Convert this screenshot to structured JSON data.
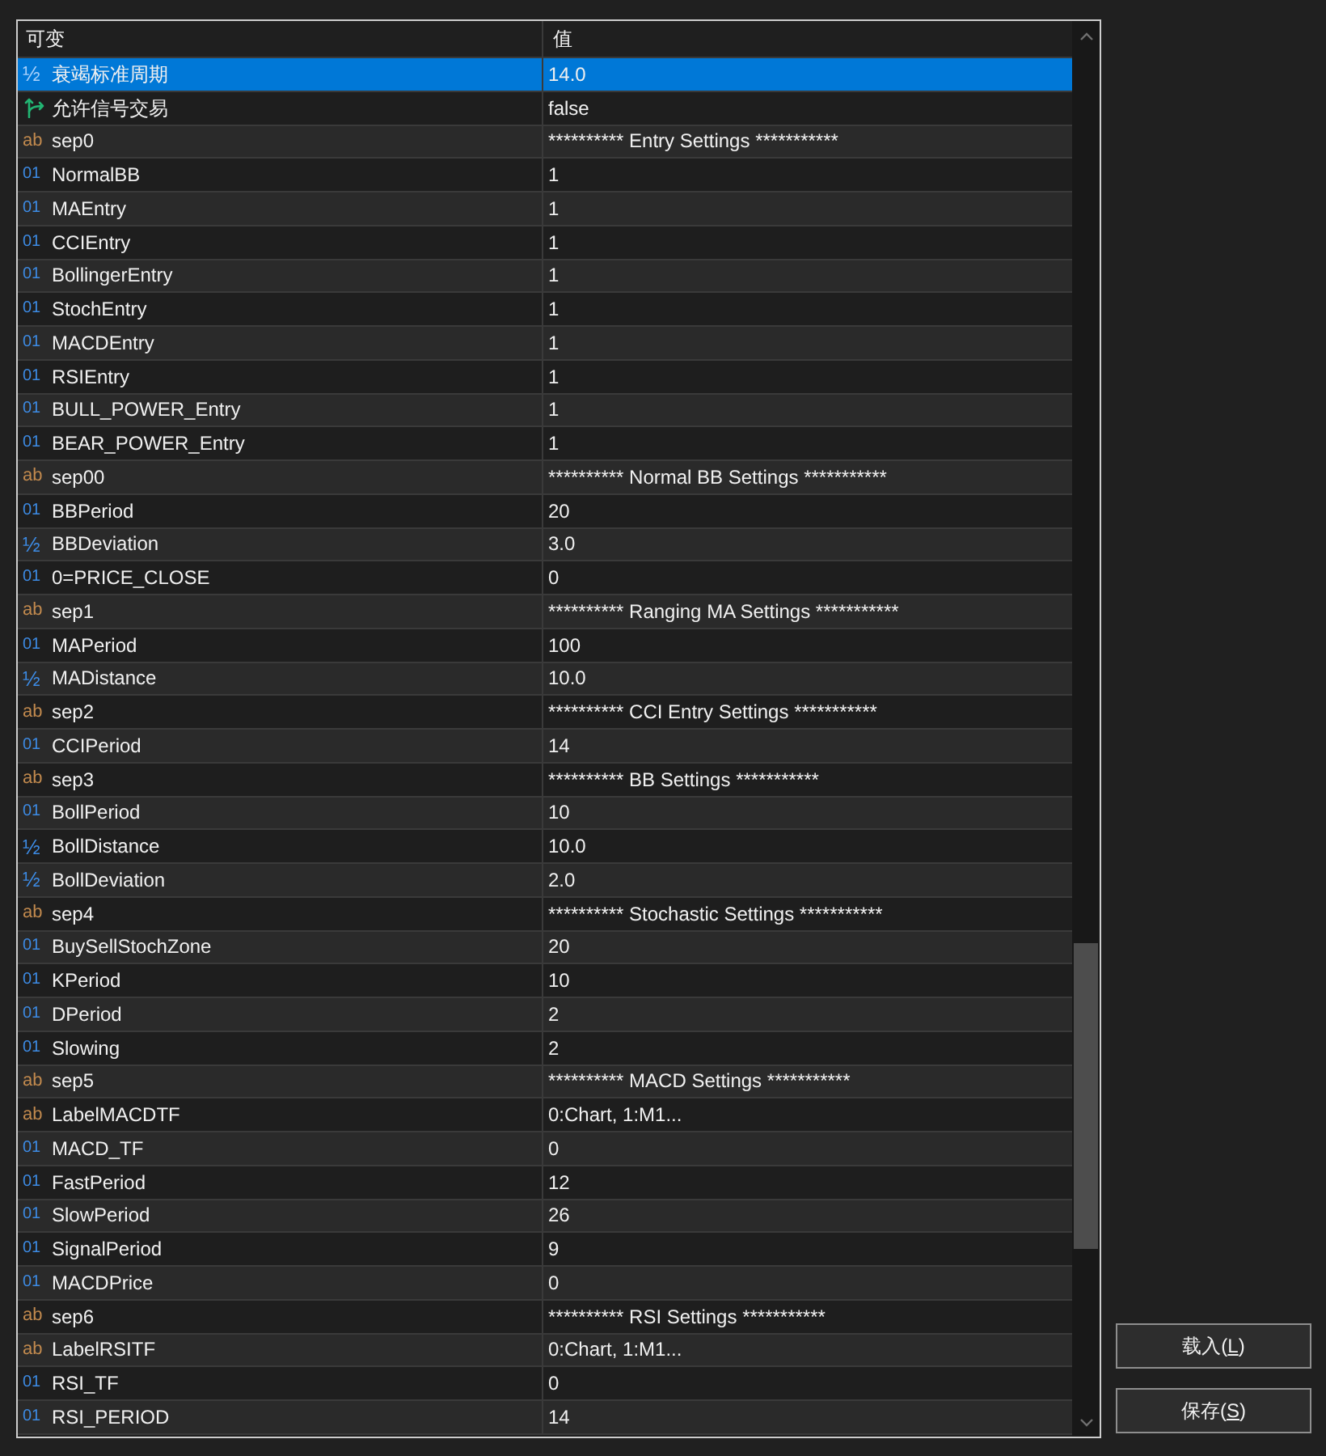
{
  "table": {
    "columns": [
      "可变",
      "值"
    ],
    "rows": [
      {
        "kind": "double",
        "icon": "½",
        "name": "衰竭标准周期",
        "value": "14.0",
        "selected": true
      },
      {
        "kind": "bool",
        "name": "允许信号交易",
        "value": "false",
        "selected": false
      },
      {
        "kind": "string",
        "icon": "ab",
        "name": "sep0",
        "value": "********** Entry Settings ***********",
        "selected": false
      },
      {
        "kind": "int",
        "icon": "01",
        "name": "NormalBB",
        "value": "1",
        "selected": false
      },
      {
        "kind": "int",
        "icon": "01",
        "name": "MAEntry",
        "value": "1",
        "selected": false
      },
      {
        "kind": "int",
        "icon": "01",
        "name": "CCIEntry",
        "value": "1",
        "selected": false
      },
      {
        "kind": "int",
        "icon": "01",
        "name": "BollingerEntry",
        "value": "1",
        "selected": false
      },
      {
        "kind": "int",
        "icon": "01",
        "name": "StochEntry",
        "value": "1",
        "selected": false
      },
      {
        "kind": "int",
        "icon": "01",
        "name": "MACDEntry",
        "value": "1",
        "selected": false
      },
      {
        "kind": "int",
        "icon": "01",
        "name": "RSIEntry",
        "value": "1",
        "selected": false
      },
      {
        "kind": "int",
        "icon": "01",
        "name": "BULL_POWER_Entry",
        "value": "1",
        "selected": false
      },
      {
        "kind": "int",
        "icon": "01",
        "name": "BEAR_POWER_Entry",
        "value": "1",
        "selected": false
      },
      {
        "kind": "string",
        "icon": "ab",
        "name": "sep00",
        "value": "********** Normal BB Settings ***********",
        "selected": false
      },
      {
        "kind": "int",
        "icon": "01",
        "name": "BBPeriod",
        "value": "20",
        "selected": false
      },
      {
        "kind": "double",
        "icon": "½",
        "name": "BBDeviation",
        "value": "3.0",
        "selected": false
      },
      {
        "kind": "int",
        "icon": "01",
        "name": "0=PRICE_CLOSE",
        "value": "0",
        "selected": false
      },
      {
        "kind": "string",
        "icon": "ab",
        "name": "sep1",
        "value": "********** Ranging MA Settings ***********",
        "selected": false
      },
      {
        "kind": "int",
        "icon": "01",
        "name": "MAPeriod",
        "value": "100",
        "selected": false
      },
      {
        "kind": "double",
        "icon": "½",
        "name": "MADistance",
        "value": "10.0",
        "selected": false
      },
      {
        "kind": "string",
        "icon": "ab",
        "name": "sep2",
        "value": "********** CCI Entry Settings ***********",
        "selected": false
      },
      {
        "kind": "int",
        "icon": "01",
        "name": "CCIPeriod",
        "value": "14",
        "selected": false
      },
      {
        "kind": "string",
        "icon": "ab",
        "name": "sep3",
        "value": "********** BB Settings ***********",
        "selected": false
      },
      {
        "kind": "int",
        "icon": "01",
        "name": "BollPeriod",
        "value": "10",
        "selected": false
      },
      {
        "kind": "double",
        "icon": "½",
        "name": "BollDistance",
        "value": "10.0",
        "selected": false
      },
      {
        "kind": "double",
        "icon": "½",
        "name": "BollDeviation",
        "value": "2.0",
        "selected": false
      },
      {
        "kind": "string",
        "icon": "ab",
        "name": "sep4",
        "value": "********** Stochastic Settings ***********",
        "selected": false
      },
      {
        "kind": "int",
        "icon": "01",
        "name": "BuySellStochZone",
        "value": "20",
        "selected": false
      },
      {
        "kind": "int",
        "icon": "01",
        "name": "KPeriod",
        "value": "10",
        "selected": false
      },
      {
        "kind": "int",
        "icon": "01",
        "name": "DPeriod",
        "value": "2",
        "selected": false
      },
      {
        "kind": "int",
        "icon": "01",
        "name": "Slowing",
        "value": "2",
        "selected": false
      },
      {
        "kind": "string",
        "icon": "ab",
        "name": "sep5",
        "value": "********** MACD Settings ***********",
        "selected": false
      },
      {
        "kind": "string",
        "icon": "ab",
        "name": "LabelMACDTF",
        "value": "0:Chart, 1:M1...",
        "selected": false
      },
      {
        "kind": "int",
        "icon": "01",
        "name": "MACD_TF",
        "value": "0",
        "selected": false
      },
      {
        "kind": "int",
        "icon": "01",
        "name": "FastPeriod",
        "value": "12",
        "selected": false
      },
      {
        "kind": "int",
        "icon": "01",
        "name": "SlowPeriod",
        "value": "26",
        "selected": false
      },
      {
        "kind": "int",
        "icon": "01",
        "name": "SignalPeriod",
        "value": "9",
        "selected": false
      },
      {
        "kind": "int",
        "icon": "01",
        "name": "MACDPrice",
        "value": "0",
        "selected": false
      },
      {
        "kind": "string",
        "icon": "ab",
        "name": "sep6",
        "value": "********** RSI Settings ***********",
        "selected": false
      },
      {
        "kind": "string",
        "icon": "ab",
        "name": "LabelRSITF",
        "value": "0:Chart, 1:M1...",
        "selected": false
      },
      {
        "kind": "int",
        "icon": "01",
        "name": "RSI_TF",
        "value": "0",
        "selected": false
      },
      {
        "kind": "int",
        "icon": "01",
        "name": "RSI_PERIOD",
        "value": "14",
        "selected": false
      }
    ]
  },
  "buttons": [
    {
      "text_before": "载入(",
      "mnemonic": "L",
      "text_after": ")"
    },
    {
      "text_before": "保存(",
      "mnemonic": "S",
      "text_after": ")"
    }
  ]
}
